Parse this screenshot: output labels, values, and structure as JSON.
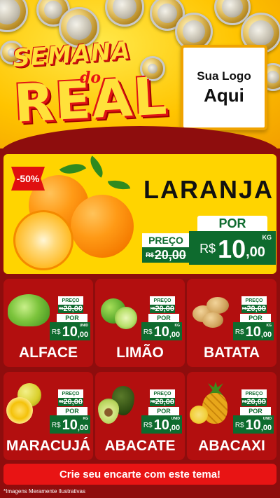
{
  "header": {
    "title_line1": "SEMANA",
    "title_connector": "do",
    "title_line2": "REAL",
    "logo_line1": "Sua Logo",
    "logo_line2": "Aqui"
  },
  "featured": {
    "discount_badge": "-50%",
    "name": "LARANJA",
    "preco_label": "PREÇO",
    "old_currency": "R$",
    "old_price": "20,00",
    "por_label": "POR",
    "currency": "R$",
    "price_int": "10",
    "price_dec": ",00",
    "unit": "KG"
  },
  "products": [
    {
      "name": "ALFACE",
      "preco_label": "PREÇO",
      "old_currency": "R$",
      "old_price": "20,00",
      "por_label": "POR",
      "currency": "R$",
      "price_int": "10",
      "price_dec": ",00",
      "unit": "UNID"
    },
    {
      "name": "LIMÃO",
      "preco_label": "PREÇO",
      "old_currency": "R$",
      "old_price": "20,00",
      "por_label": "POR",
      "currency": "R$",
      "price_int": "10",
      "price_dec": ",00",
      "unit": "KG"
    },
    {
      "name": "BATATA",
      "preco_label": "PREÇO",
      "old_currency": "R$",
      "old_price": "20,00",
      "por_label": "POR",
      "currency": "R$",
      "price_int": "10",
      "price_dec": ",00",
      "unit": "KG"
    },
    {
      "name": "MARACUJÁ",
      "preco_label": "PREÇO",
      "old_currency": "R$",
      "old_price": "20,00",
      "por_label": "POR",
      "currency": "R$",
      "price_int": "10",
      "price_dec": ",00",
      "unit": "KG"
    },
    {
      "name": "ABACATE",
      "preco_label": "PREÇO",
      "old_currency": "R$",
      "old_price": "20,00",
      "por_label": "POR",
      "currency": "R$",
      "price_int": "10",
      "price_dec": ",00",
      "unit": "UNID"
    },
    {
      "name": "ABACAXI",
      "preco_label": "PREÇO",
      "old_currency": "R$",
      "old_price": "20,00",
      "por_label": "POR",
      "currency": "R$",
      "price_int": "10",
      "price_dec": ",00",
      "unit": "UNID"
    }
  ],
  "cta_label": "Crie seu encarte com este tema!",
  "footnote": "*Imagens Meramente Ilustrativas",
  "colors": {
    "background": "#8e0d0d",
    "card": "#b30f0f",
    "price_green": "#0e6b2e",
    "header_yellow": "#ffc400",
    "cta_red": "#e81414"
  }
}
